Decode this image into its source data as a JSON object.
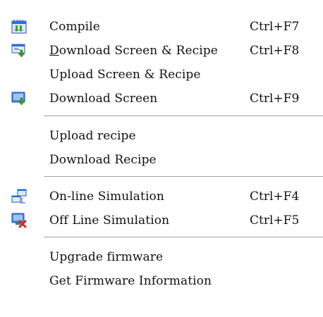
{
  "menu": {
    "items": [
      {
        "label": "Compile",
        "shortcut": "Ctrl+F7",
        "icon": "compile-icon"
      },
      {
        "label_mnemonic": "D",
        "label_rest": "ownload Screen & Recipe",
        "shortcut": "Ctrl+F8",
        "icon": "download-screen-recipe-icon"
      },
      {
        "label": "Upload Screen & Recipe",
        "shortcut": "",
        "icon": ""
      },
      {
        "label": "Download Screen",
        "shortcut": "Ctrl+F9",
        "icon": "download-screen-icon"
      },
      {
        "label": "Upload recipe",
        "shortcut": "",
        "icon": ""
      },
      {
        "label": "Download Recipe",
        "shortcut": "",
        "icon": ""
      },
      {
        "label": "On-line Simulation",
        "shortcut": "Ctrl+F4",
        "icon": "online-simulation-icon"
      },
      {
        "label": "Off Line Simulation",
        "shortcut": "Ctrl+F5",
        "icon": "offline-simulation-icon"
      },
      {
        "label": "Upgrade firmware",
        "shortcut": "",
        "icon": ""
      },
      {
        "label": "Get Firmware Information",
        "shortcut": "",
        "icon": ""
      }
    ]
  },
  "colors": {
    "separator": "#a0a0a0",
    "icon_blue": "#2a6fd6",
    "icon_green": "#3aa030",
    "icon_red": "#d02a1a"
  }
}
